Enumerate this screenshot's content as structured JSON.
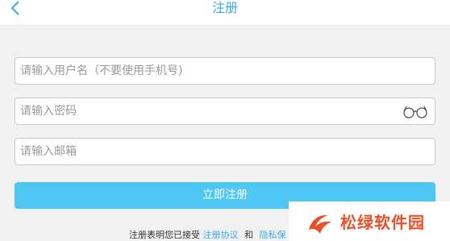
{
  "header": {
    "title": "注册",
    "back_icon": "chevron-left-icon"
  },
  "form": {
    "username_placeholder": "请输入用户名（不要使用手机号)",
    "username_value": "",
    "password_placeholder": "请输入密码",
    "password_value": "",
    "password_toggle_icon": "glasses-icon",
    "email_placeholder": "请输入邮箱",
    "email_value": ""
  },
  "submit": {
    "label": "立即注册"
  },
  "agreement": {
    "prefix": "注册表明您已接受",
    "terms_link": "注册协议",
    "and": "和",
    "privacy_link": "隐私保"
  },
  "watermark": {
    "text": "松绿软件园"
  },
  "colors": {
    "accent": "#3aa8e6",
    "button": "#4ec7f4",
    "background": "#f1f1f1",
    "watermark": "#e9502a"
  }
}
